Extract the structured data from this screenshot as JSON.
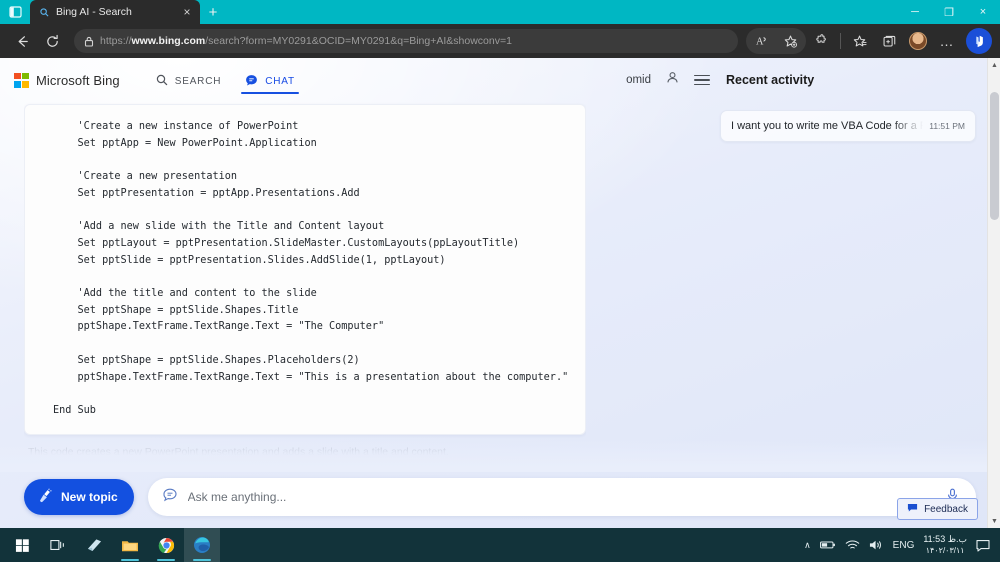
{
  "browser": {
    "tab": {
      "title": "Bing AI - Search",
      "favicon": "search-icon",
      "close": "×"
    },
    "new_tab": "+",
    "window_controls": {
      "minimize": "─",
      "maximize": "❐",
      "close": "×"
    },
    "toolbar": {
      "back": "back-arrow-icon",
      "reload": "reload-icon",
      "url_prefix": "https://",
      "url_domain": "www.bing.com",
      "url_path": "/search?form=MY0291&OCID=MY0291&q=Bing+AI&showconv=1",
      "url_full": "https://www.bing.com/search?form=MY0291&OCID=MY0291&q=Bing+AI&showconv=1",
      "read_aloud": "read-aloud-icon",
      "add_favorite": "add-favorite-icon",
      "extensions": "extensions-icon",
      "favorites": "favorites-icon",
      "collections": "collections-icon",
      "profile": "avatar-icon",
      "settings_more": "…",
      "bing_chat": "bing-chat-icon"
    }
  },
  "bing": {
    "logo_text": "Microsoft Bing",
    "tabs": [
      {
        "label": "SEARCH",
        "icon": "search-icon",
        "active": false
      },
      {
        "label": "CHAT",
        "icon": "chat-bubble-icon",
        "active": true
      }
    ],
    "user": "omid",
    "account_icon": "person-icon",
    "menu_icon": "hamburger-icon",
    "accent_color": "#1750e0"
  },
  "activity": {
    "title": "Recent activity",
    "items": [
      {
        "text": "I want you to write me VBA Code for a PowerPoint presentation",
        "time": "11:51 PM"
      }
    ]
  },
  "answer": {
    "code": "    'Create a new instance of PowerPoint\n    Set pptApp = New PowerPoint.Application\n\n    'Create a new presentation\n    Set pptPresentation = pptApp.Presentations.Add\n\n    'Add a new slide with the Title and Content layout\n    Set pptLayout = pptPresentation.SlideMaster.CustomLayouts(ppLayoutTitle)\n    Set pptSlide = pptPresentation.Slides.AddSlide(1, pptLayout)\n\n    'Add the title and content to the slide\n    Set pptShape = pptSlide.Shapes.Title\n    pptShape.TextFrame.TextRange.Text = \"The Computer\"\n\n    Set pptShape = pptSlide.Shapes.Placeholders(2)\n    pptShape.TextFrame.TextRange.Text = \"This is a presentation about the computer.\"\n\nEnd Sub",
    "trailing_text": "This code creates a new PowerPoint presentation and adds a slide with a title and content."
  },
  "composer": {
    "new_topic_label": "New topic",
    "new_topic_icon": "broom-icon",
    "input_icon": "chat-bubble-icon",
    "placeholder": "Ask me anything...",
    "value": "",
    "mic_icon": "microphone-icon"
  },
  "feedback": {
    "label": "Feedback",
    "icon": "feedback-bubble-icon"
  },
  "scrollbar": {
    "up_arrow": "▲",
    "down_arrow": "▼"
  },
  "taskbar": {
    "apps": [
      {
        "name": "start-button",
        "icon": "windows-logo-icon"
      },
      {
        "name": "task-view",
        "icon": "task-view-icon"
      },
      {
        "name": "store-app",
        "icon": "store-icon"
      },
      {
        "name": "file-explorer",
        "icon": "folder-icon"
      },
      {
        "name": "google-chrome",
        "icon": "chrome-icon"
      },
      {
        "name": "microsoft-edge",
        "icon": "edge-icon"
      }
    ],
    "tray": {
      "overflow": "∧",
      "battery": "battery-icon",
      "network": "wifi-icon",
      "volume": "speaker-icon",
      "language": "ENG",
      "time": "11:53 ب.ظ",
      "date": "۱۴۰۲/۰۳/۱۱",
      "notifications": "notification-icon"
    }
  }
}
